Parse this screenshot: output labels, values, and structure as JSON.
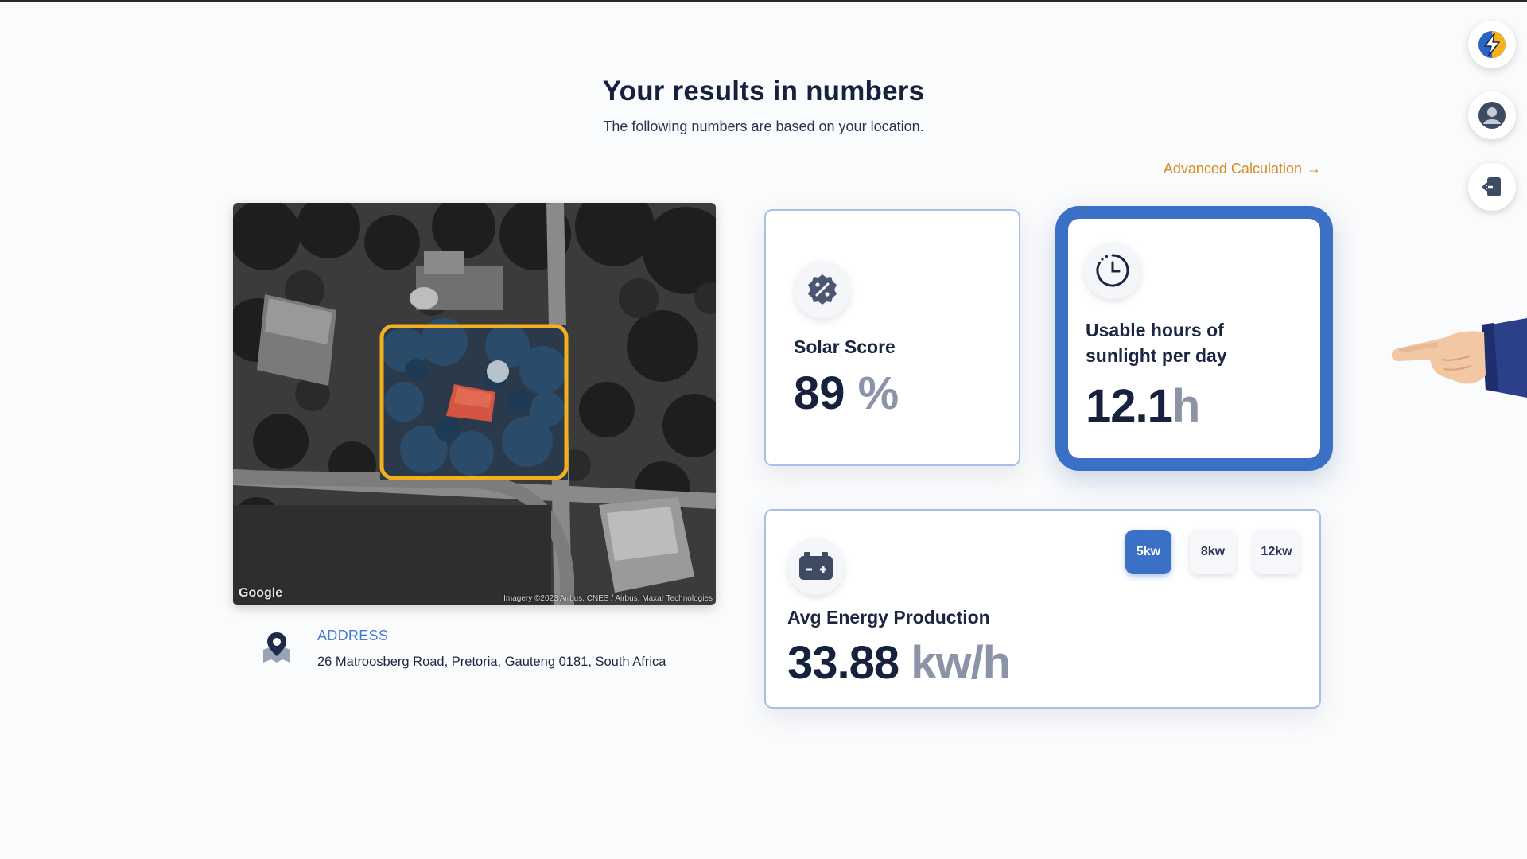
{
  "header": {
    "title": "Your results in numbers",
    "subtitle": "The following numbers are based on your location."
  },
  "advanced_link": {
    "label": "Advanced Calculation",
    "arrow": "→",
    "color": "#d98a1f"
  },
  "map": {
    "brand": "Google",
    "credit": "Imagery ©2023 Airbus, CNES / Airbus, Maxar Technologies",
    "highlight_color": "#f3b01c"
  },
  "address": {
    "label": "ADDRESS",
    "value": "26 Matroosberg Road, Pretoria, Gauteng 0181, South Africa"
  },
  "solar_score": {
    "icon": "percent-badge-icon",
    "label": "Solar Score",
    "value": "89",
    "unit": "%"
  },
  "sunlight": {
    "icon": "clock-icon",
    "label_line1": "Usable hours of",
    "label_line2": "sunlight per day",
    "value": "12.1",
    "unit": "h"
  },
  "energy": {
    "icon": "battery-icon",
    "label": "Avg Energy Production",
    "value": "33.88",
    "unit": "kw/h",
    "options": [
      "5kw",
      "8kw",
      "12kw"
    ],
    "selected": "5kw"
  },
  "rail": {
    "items": [
      "logo-icon",
      "user-icon",
      "logout-icon"
    ]
  },
  "colors": {
    "accent": "#3a70c6",
    "text": "#16213e",
    "unit_gray": "#8b93a7"
  }
}
